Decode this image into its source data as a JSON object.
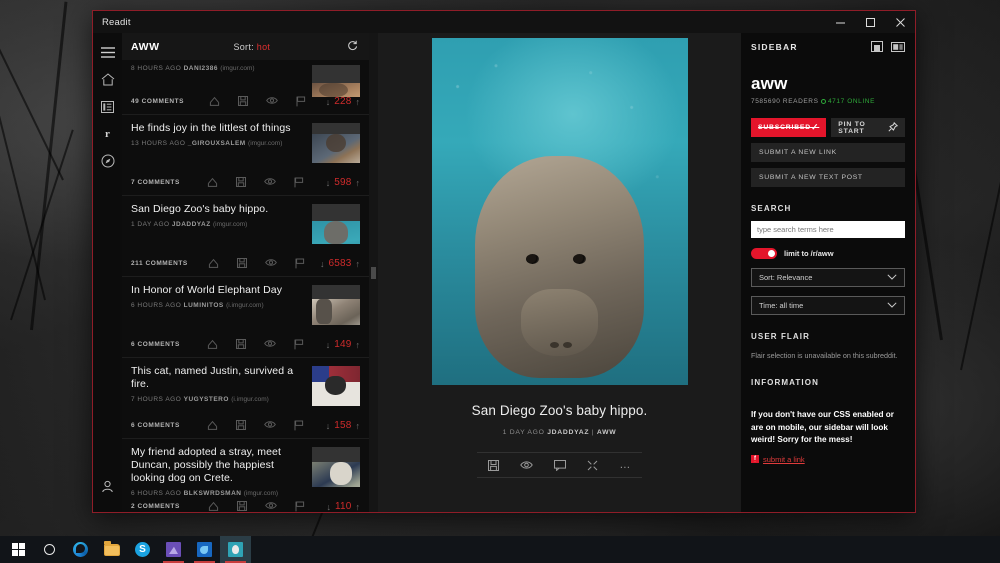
{
  "window": {
    "title": "Readit",
    "controls": {
      "minimize": "minimize-button",
      "maximize": "maximize-button",
      "close": "close-button"
    }
  },
  "rail": {
    "items": [
      {
        "name": "hamburger-menu-icon",
        "glyph": "☰"
      },
      {
        "name": "home-icon",
        "glyph": "⌂"
      },
      {
        "name": "subreddit-list-icon",
        "glyph": "☷"
      },
      {
        "name": "reddit-r-icon",
        "glyph": "r"
      },
      {
        "name": "explore-compass-icon",
        "glyph": "◎"
      }
    ],
    "account": {
      "name": "account-icon",
      "glyph": "Ⓐ"
    }
  },
  "list_header": {
    "subreddit": "AWW",
    "sort_label": "Sort:",
    "sort_value": "hot",
    "refresh_icon": "refresh-icon"
  },
  "posts": [
    {
      "title": "",
      "age": "8 HOURS AGO",
      "user": "DANI2386",
      "domain": "(imgur.com)",
      "comments": "49 COMMENTS",
      "score": "228",
      "thumb": "th-cat1",
      "partial": true
    },
    {
      "title": "He finds joy in the littlest of things",
      "age": "13 HOURS AGO",
      "user": "_GIROUXSALEM",
      "domain": "(imgur.com)",
      "comments": "7 COMMENTS",
      "score": "598",
      "thumb": "th-monkey",
      "partial": false
    },
    {
      "title": "San Diego Zoo's baby hippo.",
      "age": "1 DAY AGO",
      "user": "JDADDYAZ",
      "domain": "(imgur.com)",
      "comments": "211 COMMENTS",
      "score": "6583",
      "thumb": "th-hippo",
      "partial": false
    },
    {
      "title": "In Honor of World Elephant Day",
      "age": "6 HOURS AGO",
      "user": "LUMINITOS",
      "domain": "(i.imgur.com)",
      "comments": "6 COMMENTS",
      "score": "149",
      "thumb": "th-eleph",
      "partial": false
    },
    {
      "title": "This cat, named Justin, survived a fire.",
      "age": "7 HOURS AGO",
      "user": "YUGYSTERO",
      "domain": "(i.imgur.com)",
      "comments": "6 COMMENTS",
      "score": "158",
      "thumb": "th-justin",
      "partial": false
    },
    {
      "title": "My friend adopted a stray, meet Duncan, possibly the happiest looking dog on Crete.",
      "age": "6 HOURS AGO",
      "user": "BLKSWRDSMAN",
      "domain": "(imgur.com)",
      "comments": "2 COMMENTS",
      "score": "110",
      "thumb": "th-dog",
      "partial": false
    }
  ],
  "post_icons": [
    "upvote-arrow-icon",
    "save-icon",
    "hide-eye-icon",
    "report-flag-icon"
  ],
  "detail": {
    "image_alt": "baby-hippo-underwater-photo",
    "title": "San Diego Zoo's baby hippo.",
    "age": "1 DAY AGO",
    "user": "JDADDYAZ",
    "separator": "|",
    "subreddit": "AWW",
    "toolbar": [
      {
        "name": "save-icon",
        "glyph": "save"
      },
      {
        "name": "hide-eye-icon",
        "glyph": "eye"
      },
      {
        "name": "comments-icon",
        "glyph": "comment"
      },
      {
        "name": "share-icon",
        "glyph": "share"
      },
      {
        "name": "more-options-icon",
        "glyph": "…"
      }
    ]
  },
  "sidebar": {
    "header_label": "SIDEBAR",
    "header_icons": [
      "pane-layout-icon",
      "wide-layout-icon"
    ],
    "name": "aww",
    "readers": "7585690 READERS",
    "online": "4717 ONLINE",
    "subscribed_label": "SUBSCRIBED",
    "subscribed_check": "✓",
    "pin_label": "PIN TO START",
    "pin_icon": "pin-icon",
    "submit_link_label": "SUBMIT A NEW LINK",
    "submit_text_label": "SUBMIT A NEW TEXT POST",
    "search_section": "SEARCH",
    "search_placeholder": "type search terms here",
    "search_value": "",
    "limit_toggle_label": "limit to /r/aww",
    "sort_select": "Sort: Relevance",
    "time_select": "Time: all time",
    "flair_section": "USER FLAIR",
    "flair_text": "Flair selection is unavailable on this subreddit.",
    "info_section": "INFORMATION",
    "info_text": "If you don't have our CSS enabled or are on mobile, our sidebar will look weird! Sorry for the mess!",
    "info_link": "submit a link",
    "info_link_favicon": "f"
  },
  "taskbar": {
    "items": [
      {
        "name": "start-button",
        "kind": "win-logo"
      },
      {
        "name": "cortana-search-button",
        "kind": "cortana"
      },
      {
        "name": "edge-browser-button",
        "kind": "edge"
      },
      {
        "name": "file-explorer-button",
        "kind": "folder"
      },
      {
        "name": "skype-button",
        "kind": "skype",
        "label": "S"
      },
      {
        "name": "photos-app-button",
        "kind": "app-purple"
      },
      {
        "name": "mail-app-button",
        "kind": "app-blue"
      },
      {
        "name": "readit-app-button",
        "kind": "app-teal",
        "active": true
      }
    ]
  },
  "colors": {
    "accent_red": "#e4152b",
    "score_red": "#cf2b2b",
    "online_green": "#2faa3a",
    "window_border": "#8f1d28",
    "app_bg": "#0d0d0d",
    "detail_bg": "#1b1b1b"
  }
}
